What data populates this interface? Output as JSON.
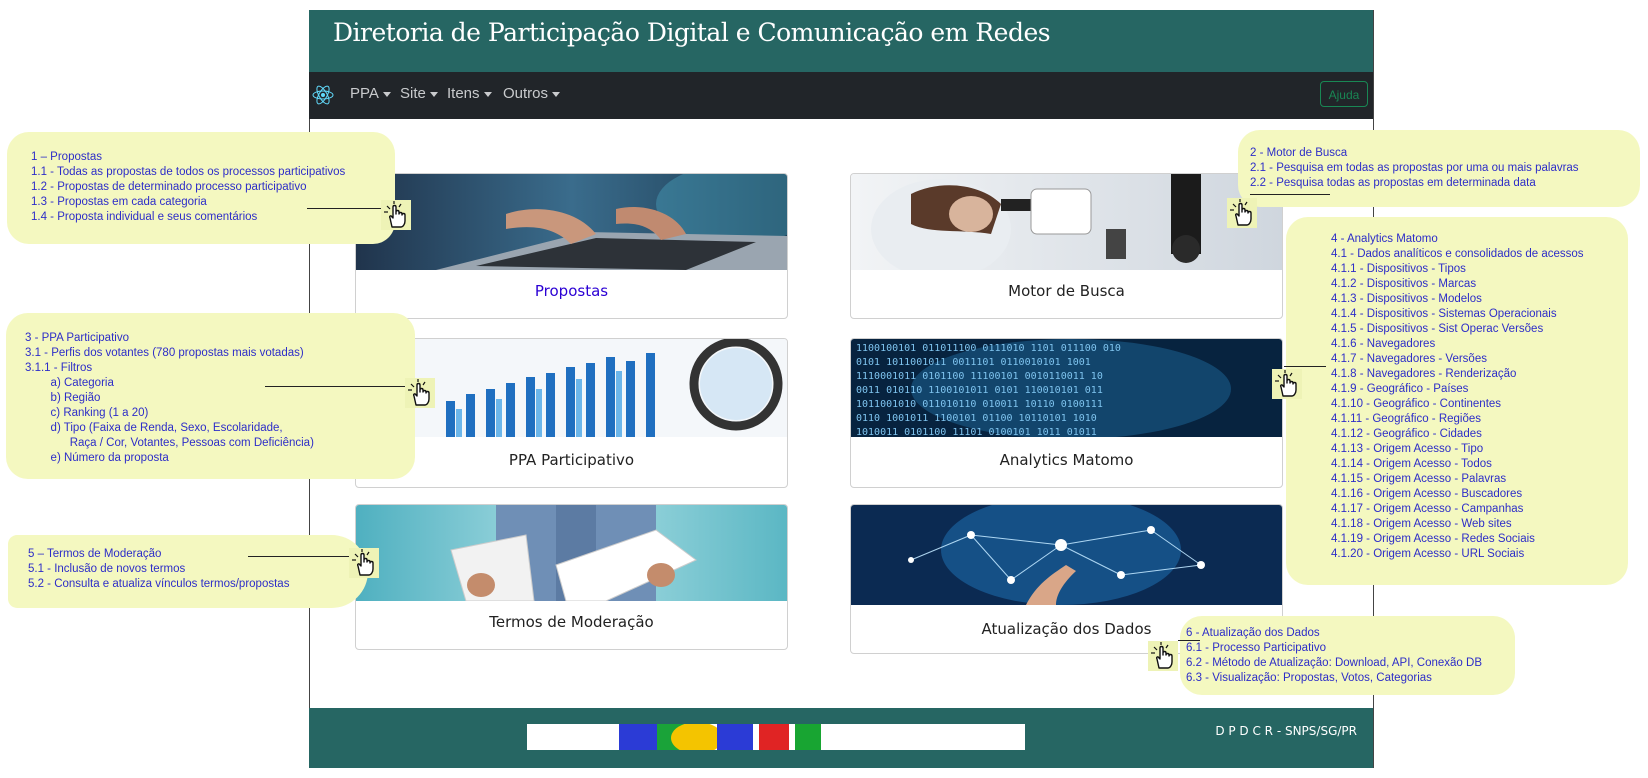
{
  "app": {
    "header_title": "Diretoria de Participação Digital e Comunicação em Redes",
    "nav": [
      {
        "label": "PPA"
      },
      {
        "label": "Site"
      },
      {
        "label": "Itens"
      },
      {
        "label": "Outros"
      }
    ],
    "help_label": "Ajuda",
    "footer_credit": "D P D C R - SNPS/SG/PR"
  },
  "cards": [
    {
      "title": "Propostas",
      "image": "laptop-typing-photo",
      "title_color": "#2b00d4"
    },
    {
      "title": "Motor de Busca",
      "image": "microscope-scientist-photo"
    },
    {
      "title": "PPA Participativo",
      "image": "bar-chart-magnifier-photo"
    },
    {
      "title": "Analytics Matomo",
      "image": "binary-code-photo"
    },
    {
      "title": "Termos de Moderação",
      "image": "person-reading-papers-photo"
    },
    {
      "title": "Atualização dos Dados",
      "image": "network-hand-photo"
    }
  ],
  "annotations": {
    "propostas": "1 – Propostas\n1.1 - Todas as propostas de todos os processos participativos\n1.2 - Propostas de determinado processo participativo\n1.3 - Propostas em cada categoria\n1.4 - Proposta individual e seus comentários",
    "motor": "2 - Motor de Busca\n2.1 - Pesquisa em todas as propostas por uma ou mais palavras\n2.2 - Pesquisa todas as propostas em determinada data",
    "ppa": "3 - PPA Participativo\n3.1 - Perfis dos votantes (780 propostas mais votadas)\n3.1.1 - Filtros\n        a) Categoria\n        b) Região\n        c) Ranking (1 a 20)\n        d) Tipo (Faixa de Renda, Sexo, Escolaridade,\n              Raça / Cor, Votantes, Pessoas com Deficiência)\n        e) Número da proposta",
    "analytics": "4 - Analytics Matomo\n4.1 - Dados analíticos e consolidados de acessos\n4.1.1 - Dispositivos - Tipos\n4.1.2 - Dispositivos - Marcas\n4.1.3 - Dispositivos - Modelos\n4.1.4 - Dispositivos - Sistemas Operacionais\n4.1.5 - Dispositivos - Sist Operac Versões\n4.1.6 - Navegadores\n4.1.7 - Navegadores - Versões\n4.1.8 - Navegadores - Renderização\n4.1.9 - Geográfico - Países\n4.1.10 - Geográfico - Continentes\n4.1.11 - Geográfico - Regiões\n4.1.12 - Geográfico - Cidades\n4.1.13 - Origem Acesso - Tipo\n4.1.14 - Origem Acesso - Todos\n4.1.15 - Origem Acesso - Palavras\n4.1.16 - Origem Acesso - Buscadores\n4.1.17 - Origem Acesso - Campanhas\n4.1.18 - Origem Acesso - Web sites\n4.1.19 - Origem Acesso - Redes Sociais\n4.1.20 - Origem Acesso - URL Sociais",
    "termos": "5 – Termos de Moderação\n5.1 - Inclusão de novos termos\n5.2 - Consulta e atualiza vínculos termos/propostas",
    "atualizacao": "6 - Atualização dos Dados\n6.1 - Processo Participativo\n6.2 - Método de Atualização: Download, API, Conexão DB\n6.3 - Visualização: Propostas, Votos, Categorias"
  },
  "colors": {
    "header_bg": "#266663",
    "navbar_bg": "#212529",
    "callout_bg": "#f4f8c0",
    "callout_text": "#2d2dc8",
    "help_green": "#198754"
  },
  "icons": [
    "react-logo-icon",
    "pointing-hand-cursor-icon"
  ]
}
